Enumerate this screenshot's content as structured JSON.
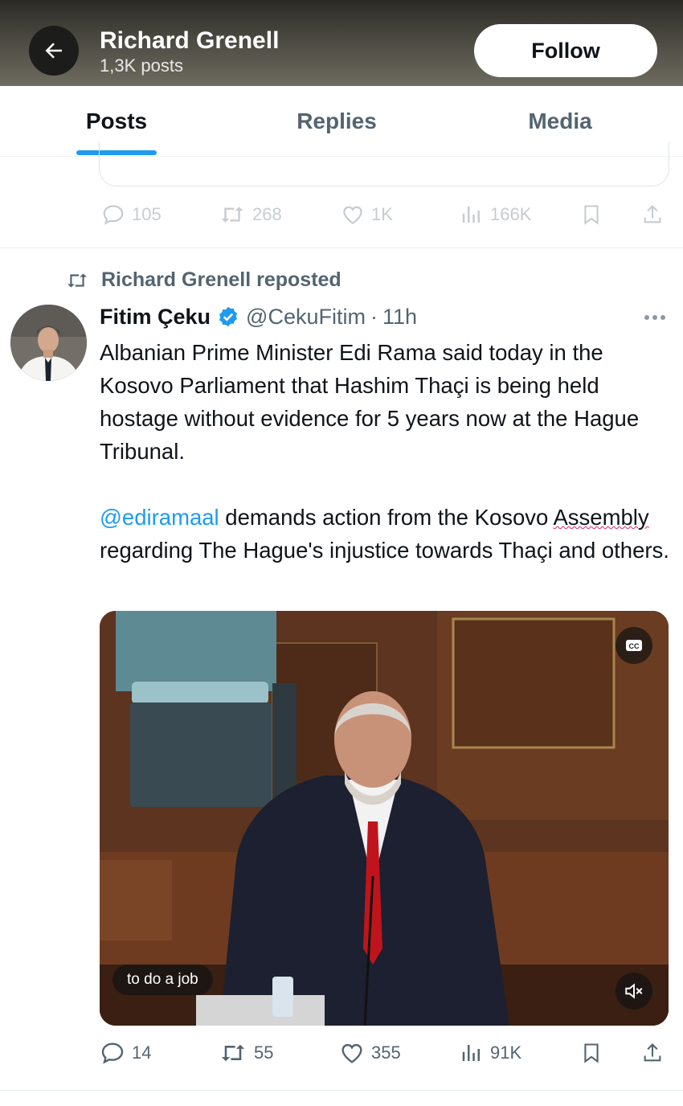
{
  "header": {
    "back_icon": "arrow-left-icon",
    "title": "Richard Grenell",
    "subtitle": "1,3K posts",
    "follow_label": "Follow"
  },
  "tabs": [
    {
      "label": "Posts",
      "active": true
    },
    {
      "label": "Replies",
      "active": false
    },
    {
      "label": "Media",
      "active": false
    }
  ],
  "previous_post": {
    "replies": "105",
    "reposts": "268",
    "likes": "1K",
    "views": "166K"
  },
  "post": {
    "repost_label": "Richard Grenell reposted",
    "author_name": "Fitim Çeku",
    "handle": "@CekuFitim",
    "separator": "·",
    "time": "11h",
    "paragraph1": "Albanian Prime Minister Edi Rama said today in the Kosovo Parliament that Hashim Thaçi is being held hostage without evidence for 5 years now at the Hague Tribunal.",
    "mention": "@ediramaal",
    "paragraph2_part1": " demands action from the Kosovo ",
    "paragraph2_misspelled": "Assembly",
    "paragraph2_part2": " regarding The Hague's injustice towards Thaçi and others.",
    "video": {
      "caption": "to do a job",
      "cc_label": "CC"
    },
    "stats": {
      "replies": "14",
      "reposts": "55",
      "likes": "355",
      "views": "91K"
    }
  },
  "colors": {
    "accent": "#1d9bf0",
    "muted": "#536471",
    "text": "#0f1419"
  }
}
